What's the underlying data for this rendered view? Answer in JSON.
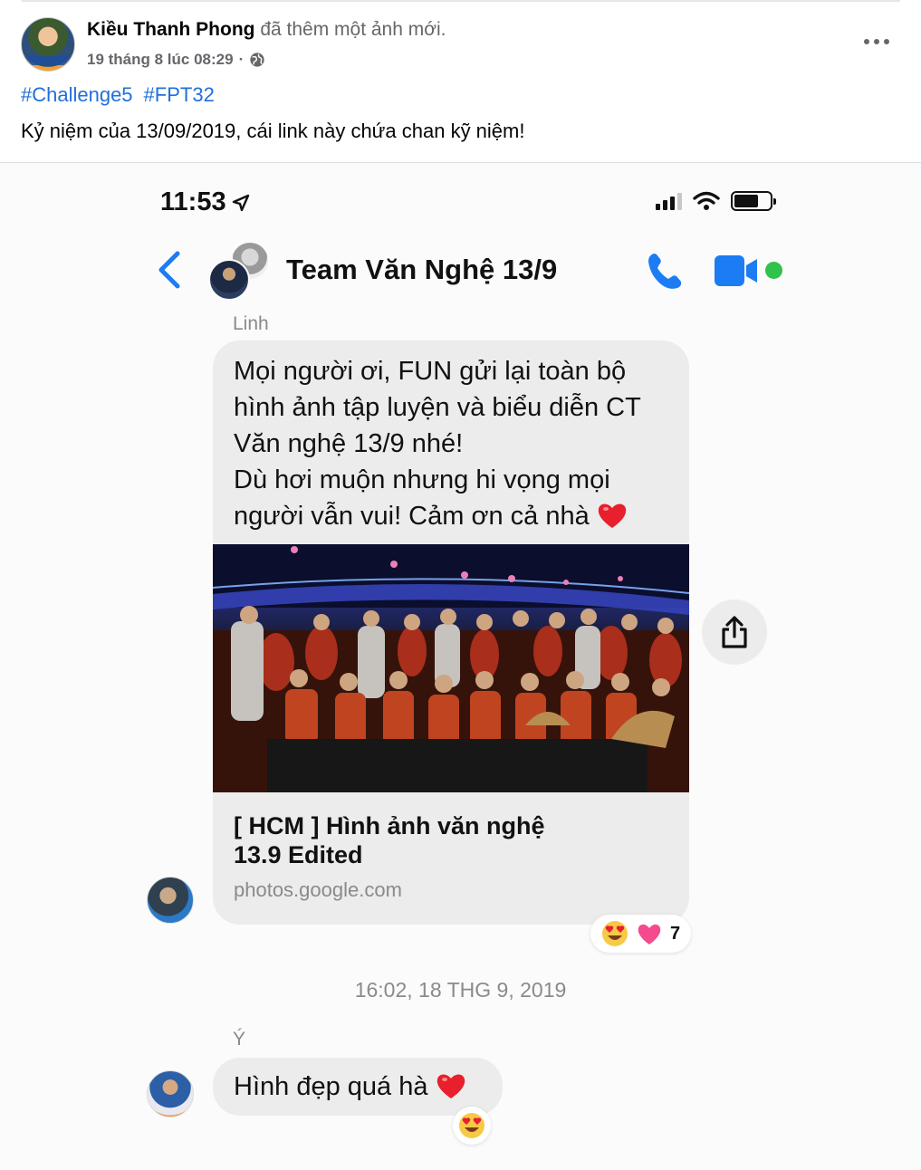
{
  "post": {
    "author": "Kiều Thanh Phong",
    "action": "đã thêm một ảnh mới.",
    "date": "19 tháng 8 lúc 08:29",
    "date_separator": "·",
    "privacy_icon": "globe-icon",
    "more_icon": "more-options-icon",
    "hashtags": [
      "#Challenge5",
      "#FPT32"
    ],
    "caption": "Kỷ niệm của 13/09/2019, cái link này chứa chan kỹ niệm!"
  },
  "phone": {
    "time": "11:53",
    "location_icon": "location-arrow-icon",
    "signal_icon": "cellular-signal-icon",
    "wifi_icon": "wifi-icon",
    "battery_icon": "battery-icon"
  },
  "conversation": {
    "title": "Team Văn Nghệ 13/9",
    "back_icon": "back-chevron-icon",
    "call_icon": "phone-call-icon",
    "video_icon": "video-call-icon",
    "accent_color": "#1b7cf4",
    "online_color": "#31c24d"
  },
  "messages": [
    {
      "sender": "Linh",
      "lines": [
        "Mọi người ơi, FUN gửi lại toàn bộ",
        "hình ảnh tập luyện và biểu diễn CT",
        "Văn nghệ 13/9 nhé!",
        "Dù hơi muộn nhưng hi vọng mọi",
        "người vẫn vui! Cảm ơn cả nhà"
      ],
      "emoji": "red-heart-icon",
      "link": {
        "title_line1": "[ HCM ] Hình ảnh văn nghệ",
        "title_line2": "13.9 Edited",
        "domain": "photos.google.com"
      },
      "reactions": {
        "icons": [
          "heart-eyes-icon",
          "pink-heart-icon"
        ],
        "count": "7"
      }
    },
    {
      "timestamp": "16:02, 18 THG 9, 2019"
    },
    {
      "sender": "Ý",
      "text": "Hình đẹp quá hà",
      "emoji": "red-heart-icon",
      "reactions": {
        "icons": [
          "heart-eyes-icon"
        ]
      }
    }
  ]
}
